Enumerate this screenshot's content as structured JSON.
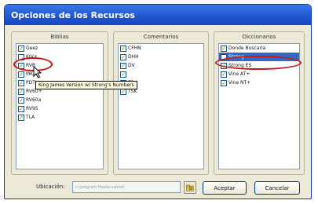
{
  "window": {
    "title": "Opciones de los Recursos"
  },
  "groups": {
    "biblias": {
      "title": "Biblias",
      "items": [
        {
          "label": "Geez",
          "checked": true
        },
        {
          "label": "KJV+",
          "checked": false
        },
        {
          "label": "RVR",
          "checked": true
        },
        {
          "label": "MKJV",
          "checked": true
        },
        {
          "label": "PDT",
          "checked": true
        },
        {
          "label": "RV60+",
          "checked": true
        },
        {
          "label": "RV60a",
          "checked": true
        },
        {
          "label": "RV95",
          "checked": true
        },
        {
          "label": "TLA",
          "checked": true
        }
      ],
      "tooltip": "King James Version w/ Strong's Numbers"
    },
    "comentarios": {
      "title": "Comentarios",
      "items": [
        {
          "label": "CFHN",
          "checked": true
        },
        {
          "label": "DHH",
          "checked": true
        },
        {
          "label": "DV",
          "checked": true
        },
        {
          "label": "",
          "checked": true
        },
        {
          "label": "EP",
          "checked": true
        },
        {
          "label": "TSK",
          "checked": true
        }
      ]
    },
    "diccionarios": {
      "title": "Diccionarios",
      "items": [
        {
          "label": "Donde Buscarla",
          "checked": true
        },
        {
          "label": "Strong",
          "checked": false,
          "selected": true
        },
        {
          "label": "Strong ES",
          "checked": true
        },
        {
          "label": "Vine AT+",
          "checked": true
        },
        {
          "label": "Vine NT+",
          "checked": true
        }
      ]
    }
  },
  "footer": {
    "location_label": "Ubicación:",
    "location_value": "c:\\program files\\e-sword\\",
    "accept_label": "Aceptar",
    "cancel_label": "Cancelar"
  },
  "icons": {
    "browse": "folder-browse-icon",
    "cursor": "mouse-pointer-icon"
  },
  "colors": {
    "title_bar": "#1f55d0",
    "selection": "#316ac5",
    "highlight_ellipse": "#c81818",
    "checkmark": "#21a121"
  }
}
